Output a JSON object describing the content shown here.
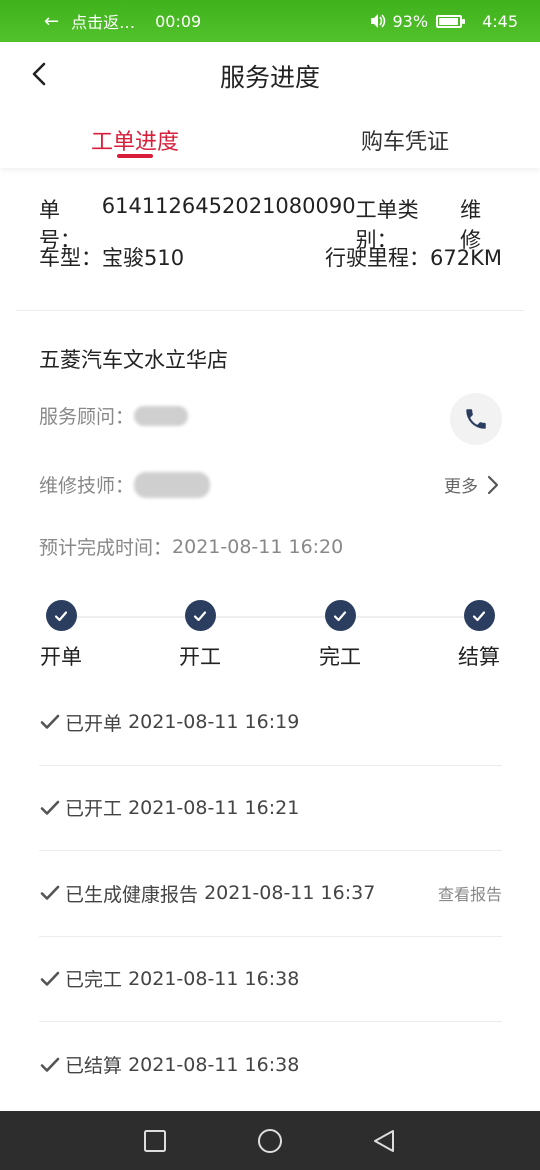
{
  "status_bar": {
    "back_label": "点击返…",
    "call_timer": "00:09",
    "battery_percent": "93%",
    "battery_level": 0.93,
    "clock": "4:45",
    "color": "#4cba25"
  },
  "header": {
    "title": "服务进度",
    "back_icon": "chevron-left-icon"
  },
  "tabs": [
    {
      "label": "工单进度",
      "active": true
    },
    {
      "label": "购车凭证",
      "active": false
    }
  ],
  "order": {
    "number_label": "单号：",
    "number": "6141126452021080090",
    "type_label": "工单类别：",
    "type": "维修",
    "model_label": "车型：",
    "model": "宝骏510",
    "mileage_label": "行驶里程：",
    "mileage": "672KM"
  },
  "store": {
    "name": "五菱汽车文水立华店",
    "advisor_label": "服务顾问：",
    "technician_label": "维修技师：",
    "more_label": "更多",
    "eta_label": "预计完成时间：",
    "eta": "2021-08-11 16:20",
    "phone_icon": "phone-icon"
  },
  "steps": [
    {
      "label": "开单",
      "done": true
    },
    {
      "label": "开工",
      "done": true
    },
    {
      "label": "完工",
      "done": true
    },
    {
      "label": "结算",
      "done": true
    }
  ],
  "timeline": [
    {
      "text": "已开单",
      "time": "2021-08-11 16:19",
      "link": ""
    },
    {
      "text": "已开工",
      "time": "2021-08-11 16:21",
      "link": ""
    },
    {
      "text": "已生成健康报告",
      "time": "2021-08-11 16:37",
      "link": "查看报告"
    },
    {
      "text": "已完工",
      "time": "2021-08-11 16:38",
      "link": ""
    },
    {
      "text": "已结算",
      "time": "2021-08-11 16:38",
      "link": ""
    }
  ],
  "colors": {
    "accent": "#d81e3a",
    "step": "#2c3e60",
    "navbar": "#2d2d2d"
  }
}
